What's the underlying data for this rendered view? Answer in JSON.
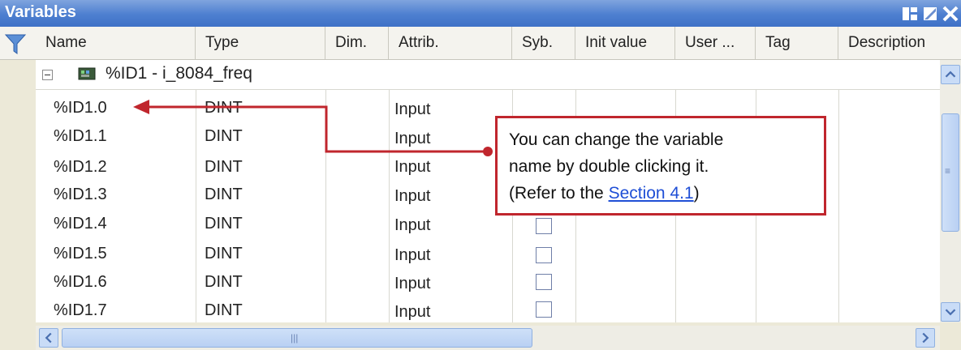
{
  "window": {
    "title": "Variables"
  },
  "columns": [
    "Name",
    "Type",
    "Dim.",
    "Attrib.",
    "Syb.",
    "Init value",
    "User ...",
    "Tag",
    "Description"
  ],
  "group": {
    "label": "%ID1 - i_8084_freq"
  },
  "rows": [
    {
      "name": "%ID1.0",
      "type": "DINT",
      "attrib": "Input",
      "symbol": false
    },
    {
      "name": "%ID1.1",
      "type": "DINT",
      "attrib": "Input",
      "symbol": false
    },
    {
      "name": "%ID1.2",
      "type": "DINT",
      "attrib": "Input",
      "symbol": false
    },
    {
      "name": "%ID1.3",
      "type": "DINT",
      "attrib": "Input",
      "symbol": false
    },
    {
      "name": "%ID1.4",
      "type": "DINT",
      "attrib": "Input",
      "symbol": false
    },
    {
      "name": "%ID1.5",
      "type": "DINT",
      "attrib": "Input",
      "symbol": false
    },
    {
      "name": "%ID1.6",
      "type": "DINT",
      "attrib": "Input",
      "symbol": false
    },
    {
      "name": "%ID1.7",
      "type": "DINT",
      "attrib": "Input",
      "symbol": false
    }
  ],
  "callout": {
    "line1": "You can change the variable",
    "line2": "name by double clicking it.",
    "line3_prefix": "(Refer to the ",
    "line3_link": "Section 4.1",
    "line3_suffix": ")"
  },
  "colors": {
    "callout_border": "#c0262d",
    "title_bar": "#4d7fd0",
    "link": "#1f4fd6"
  },
  "icons": [
    "filter-icon",
    "dock-icon",
    "restore-icon",
    "close-icon",
    "collapse-icon",
    "device-icon",
    "scroll-up-icon",
    "scroll-down-icon",
    "scroll-left-icon",
    "scroll-right-icon"
  ]
}
